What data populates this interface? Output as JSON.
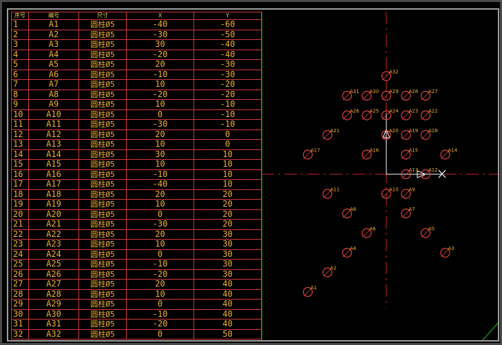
{
  "table": {
    "headers": [
      "序号",
      "编号",
      "尺寸",
      "X",
      "Y"
    ],
    "rows": [
      [
        "1",
        "A1",
        "圆柱Ø5",
        "-40",
        "-60"
      ],
      [
        "2",
        "A2",
        "圆柱Ø5",
        "-30",
        "-50"
      ],
      [
        "3",
        "A3",
        "圆柱Ø5",
        "30",
        "-40"
      ],
      [
        "4",
        "A4",
        "圆柱Ø5",
        "-20",
        "-40"
      ],
      [
        "5",
        "A5",
        "圆柱Ø5",
        "20",
        "-30"
      ],
      [
        "6",
        "A6",
        "圆柱Ø5",
        "-10",
        "-30"
      ],
      [
        "7",
        "A7",
        "圆柱Ø5",
        "10",
        "-20"
      ],
      [
        "8",
        "A8",
        "圆柱Ø5",
        "-20",
        "-20"
      ],
      [
        "9",
        "A9",
        "圆柱Ø5",
        "10",
        "-10"
      ],
      [
        "10",
        "A10",
        "圆柱Ø5",
        "0",
        "-10"
      ],
      [
        "11",
        "A11",
        "圆柱Ø5",
        "-30",
        "-10"
      ],
      [
        "12",
        "A12",
        "圆柱Ø5",
        "20",
        "0"
      ],
      [
        "13",
        "A13",
        "圆柱Ø5",
        "10",
        "0"
      ],
      [
        "14",
        "A14",
        "圆柱Ø5",
        "30",
        "10"
      ],
      [
        "15",
        "A15",
        "圆柱Ø5",
        "10",
        "10"
      ],
      [
        "16",
        "A16",
        "圆柱Ø5",
        "-10",
        "10"
      ],
      [
        "17",
        "A17",
        "圆柱Ø5",
        "-40",
        "10"
      ],
      [
        "18",
        "A18",
        "圆柱Ø5",
        "20",
        "20"
      ],
      [
        "19",
        "A19",
        "圆柱Ø5",
        "10",
        "20"
      ],
      [
        "20",
        "A20",
        "圆柱Ø5",
        "0",
        "20"
      ],
      [
        "21",
        "A21",
        "圆柱Ø5",
        "-30",
        "20"
      ],
      [
        "22",
        "A22",
        "圆柱Ø5",
        "20",
        "30"
      ],
      [
        "23",
        "A23",
        "圆柱Ø5",
        "10",
        "30"
      ],
      [
        "24",
        "A24",
        "圆柱Ø5",
        "0",
        "30"
      ],
      [
        "25",
        "A25",
        "圆柱Ø5",
        "-10",
        "30"
      ],
      [
        "26",
        "A26",
        "圆柱Ø5",
        "-20",
        "30"
      ],
      [
        "27",
        "A27",
        "圆柱Ø5",
        "20",
        "40"
      ],
      [
        "28",
        "A28",
        "圆柱Ø5",
        "10",
        "40"
      ],
      [
        "29",
        "A29",
        "圆柱Ø5",
        "0",
        "40"
      ],
      [
        "30",
        "A30",
        "圆柱Ø5",
        "-10",
        "40"
      ],
      [
        "31",
        "A31",
        "圆柱Ø5",
        "-20",
        "40"
      ],
      [
        "32",
        "A32",
        "圆柱Ø5",
        "0",
        "50"
      ]
    ]
  },
  "drawing": {
    "colors": {
      "table_line": "#d23a3a",
      "table_text": "#f0b030",
      "crosshair": "#cc2222",
      "axis": "#ffffff",
      "hole": "#e04040",
      "divider": "#22c022"
    },
    "origin_marker": "cross-cursor-icon"
  }
}
